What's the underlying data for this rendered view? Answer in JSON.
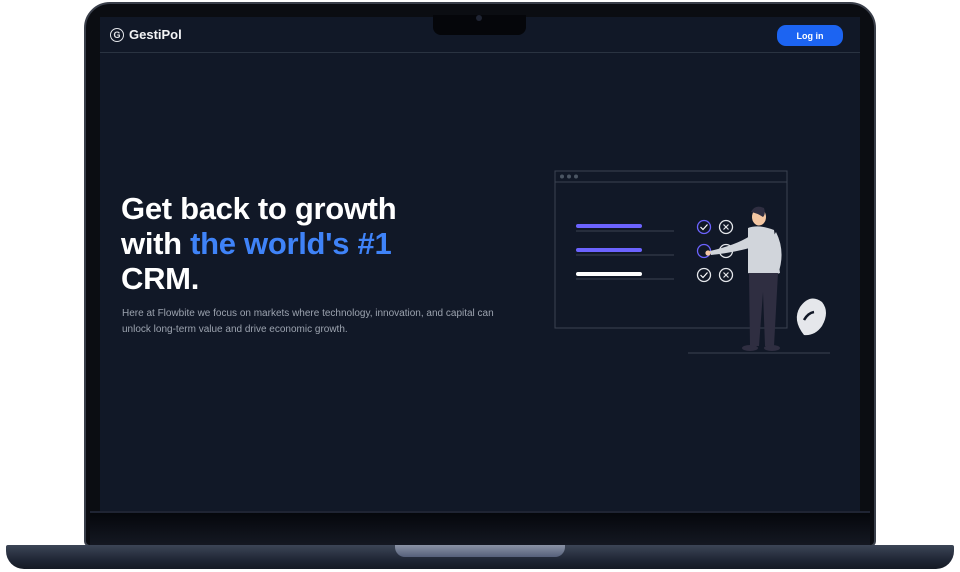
{
  "navbar": {
    "brand": "GestiPol",
    "brand_icon": "copyright-circle-icon",
    "login_label": "Log in"
  },
  "hero": {
    "title_line1": "Get back to growth",
    "title_line2_prefix": "with ",
    "title_line2_accent": "the world's #1",
    "title_line3": "CRM.",
    "description": "Here at Flowbite we focus on markets where technology, innovation, and capital can unlock long-term value and drive economic growth."
  },
  "colors": {
    "background": "#111827",
    "accent": "#3f83f8",
    "button": "#1c64f2",
    "illustration_purple": "#6c63ff"
  }
}
